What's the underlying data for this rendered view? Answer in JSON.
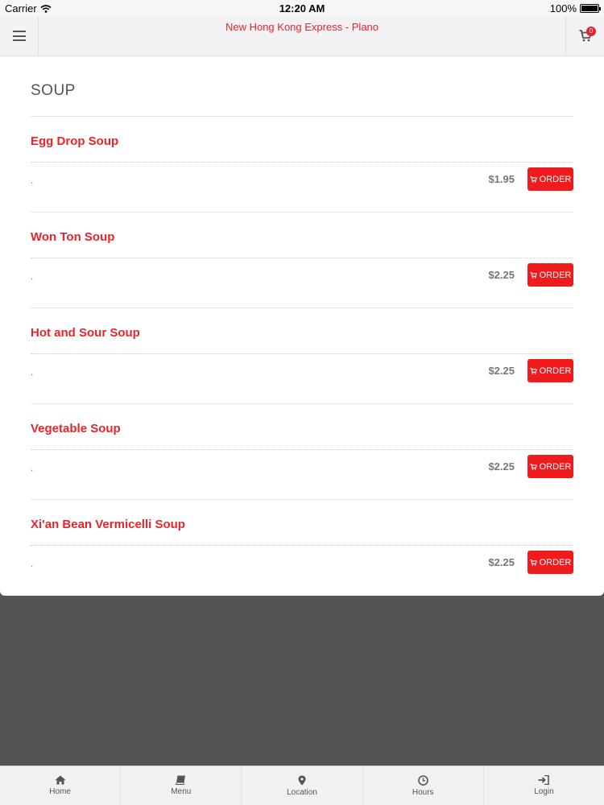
{
  "status_bar": {
    "carrier": "Carrier",
    "time": "12:20 AM",
    "battery": "100%"
  },
  "navbar": {
    "title": "New Hong Kong Express - Plano",
    "cart_count": "0",
    "menu_icon": "hamburger-icon",
    "cart_icon": "cart-icon"
  },
  "section": {
    "title": "SOUP"
  },
  "items": [
    {
      "name": "Egg Drop Soup",
      "desc": ".",
      "price": "$1.95",
      "order_label": "ORDER"
    },
    {
      "name": "Won Ton Soup",
      "desc": ".",
      "price": "$2.25",
      "order_label": "ORDER"
    },
    {
      "name": "Hot and Sour Soup",
      "desc": ".",
      "price": "$2.25",
      "order_label": "ORDER"
    },
    {
      "name": "Vegetable Soup",
      "desc": ".",
      "price": "$2.25",
      "order_label": "ORDER"
    },
    {
      "name": "Xi'an Bean Vermicelli Soup",
      "desc": ".",
      "price": "$2.25",
      "order_label": "ORDER"
    }
  ],
  "tabs": [
    {
      "label": "Home",
      "icon": "home-icon"
    },
    {
      "label": "Menu",
      "icon": "book-icon"
    },
    {
      "label": "Location",
      "icon": "map-pin-icon"
    },
    {
      "label": "Hours",
      "icon": "clock-icon"
    },
    {
      "label": "Login",
      "icon": "login-icon"
    }
  ],
  "colors": {
    "accent": "#e8242a",
    "order_button": "#ef1b1d",
    "background": "#545356"
  }
}
